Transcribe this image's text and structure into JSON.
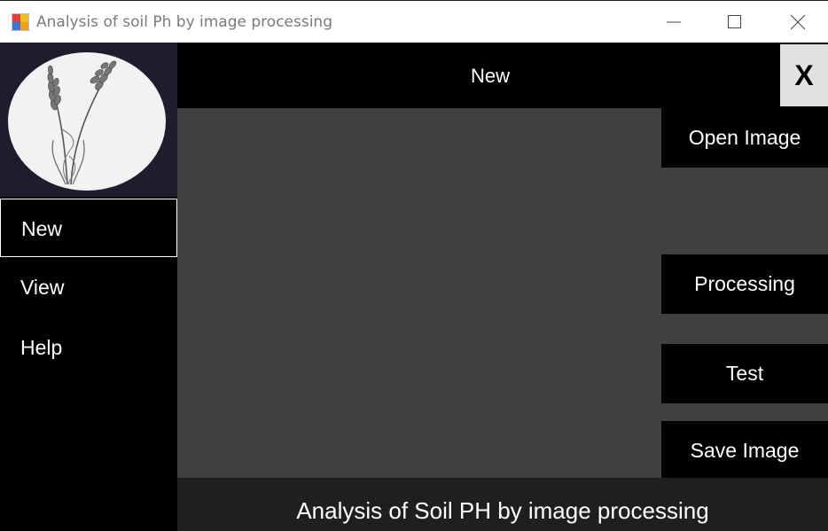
{
  "window": {
    "title": "Analysis of soil Ph by image processing",
    "icon": "app-icon"
  },
  "sidebar": {
    "logo": "wheat-logo",
    "items": [
      {
        "label": "New",
        "active": true
      },
      {
        "label": "View",
        "active": false
      },
      {
        "label": "Help",
        "active": false
      }
    ]
  },
  "header": {
    "title": "New",
    "close_label": "X"
  },
  "actions": {
    "open_image": "Open Image",
    "processing": "Processing",
    "test": "Test",
    "save_image": "Save Image"
  },
  "footer": {
    "text": "Analysis of Soil PH by image processing"
  },
  "colors": {
    "sidebar_bg": "#000000",
    "logo_bg": "#1e1d2d",
    "work_area": "#404040",
    "footer_bg": "#1f1f1f",
    "close_bg": "#e1e1e1"
  }
}
